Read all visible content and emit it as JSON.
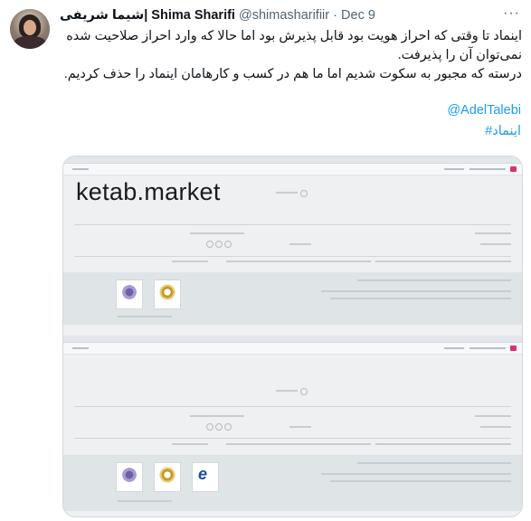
{
  "tweet": {
    "display_name": "شیما شریفی| Shima Sharifi",
    "handle": "@shimasharifiir",
    "separator": "·",
    "date": "Dec 9",
    "more_label": "···",
    "body_lines": [
      "اینماد تا وقتی که احراز هویت بود قابل پذیرش بود اما حالا که وارد احراز صلاحیت شده",
      "نمی‌توان آن را پذیرفت.",
      "درسته که مجبور به سکوت شدیم اما ما هم در کسب و کارهامان اینماد را حذف کردیم."
    ],
    "mention": "@AdelTalebi",
    "hashtag": "#اینماد"
  },
  "media": {
    "site_title": "ketab.market",
    "badges_before": [
      "seal-badge",
      "gold-badge"
    ],
    "badges_after": [
      "seal-badge",
      "gold-badge",
      "enamad-badge"
    ]
  }
}
